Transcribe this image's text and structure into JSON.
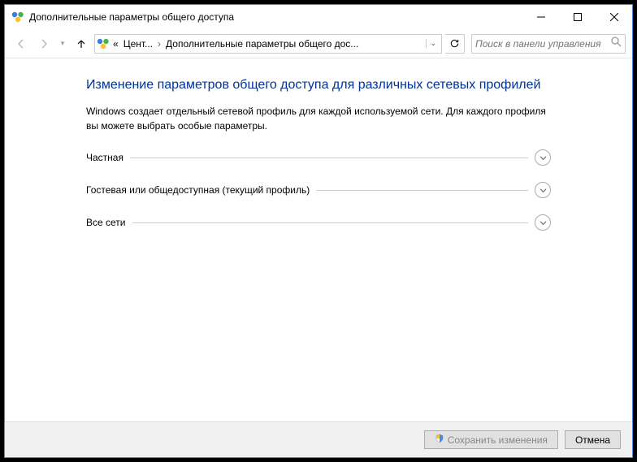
{
  "window": {
    "title": "Дополнительные параметры общего доступа"
  },
  "breadcrumb": {
    "root_prefix": "«",
    "item1": "Цент...",
    "item2": "Дополнительные параметры общего дос..."
  },
  "search": {
    "placeholder": "Поиск в панели управления"
  },
  "main": {
    "heading": "Изменение параметров общего доступа для различных сетевых профилей",
    "description": "Windows создает отдельный сетевой профиль для каждой используемой сети. Для каждого профиля вы можете выбрать особые параметры."
  },
  "profiles": [
    {
      "label": "Частная"
    },
    {
      "label": "Гостевая или общедоступная (текущий профиль)"
    },
    {
      "label": "Все сети"
    }
  ],
  "footer": {
    "save": "Сохранить изменения",
    "cancel": "Отмена"
  }
}
